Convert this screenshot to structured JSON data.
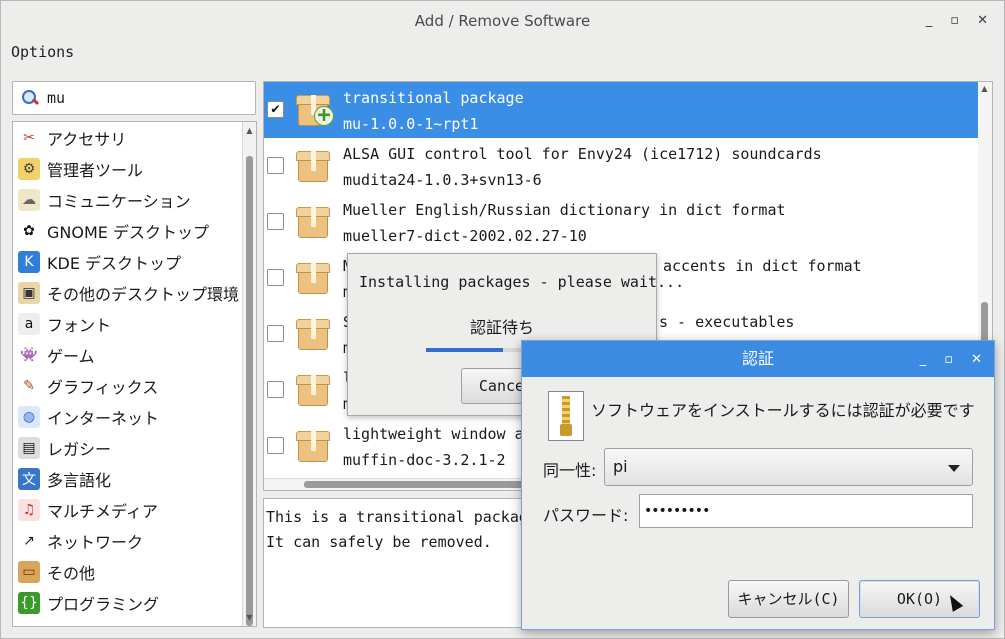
{
  "window": {
    "title": "Add / Remove Software",
    "controls": [
      "_",
      "▫",
      "✕"
    ]
  },
  "menu": {
    "options": "Options"
  },
  "search": {
    "value": "mu"
  },
  "categories": [
    {
      "label": "アクセサリ",
      "icon": "accessories-icon"
    },
    {
      "label": "管理者ツール",
      "icon": "admin-tools-icon"
    },
    {
      "label": "コミュニケーション",
      "icon": "communication-icon"
    },
    {
      "label": "GNOME デスクトップ",
      "icon": "gnome-icon"
    },
    {
      "label": "KDE デスクトップ",
      "icon": "kde-icon"
    },
    {
      "label": "その他のデスクトップ環境",
      "icon": "other-desktop-icon"
    },
    {
      "label": "フォント",
      "icon": "font-icon"
    },
    {
      "label": "ゲーム",
      "icon": "games-icon"
    },
    {
      "label": "グラフィックス",
      "icon": "graphics-icon"
    },
    {
      "label": "インターネット",
      "icon": "internet-icon"
    },
    {
      "label": "レガシー",
      "icon": "legacy-icon"
    },
    {
      "label": "多言語化",
      "icon": "localization-icon"
    },
    {
      "label": "マルチメディア",
      "icon": "multimedia-icon"
    },
    {
      "label": "ネットワーク",
      "icon": "network-icon"
    },
    {
      "label": "その他",
      "icon": "other-icon"
    },
    {
      "label": "プログラミング",
      "icon": "programming-icon"
    }
  ],
  "packages": [
    {
      "summary": "transitional package",
      "name": "mu-1.0.0-1~rpt1",
      "checked": true
    },
    {
      "summary": "ALSA GUI control tool for Envy24 (ice1712) soundcards",
      "name": "mudita24-1.0.3+svn13-6",
      "checked": false
    },
    {
      "summary": "Mueller English/Russian dictionary in dict format",
      "name": "mueller7-dict-2002.02.27-10",
      "checked": false
    },
    {
      "summary": "accents in dict format",
      "name": "m",
      "prefix": "M",
      "checked": false
    },
    {
      "summary": "s - executables",
      "name": "m",
      "prefix": "S",
      "checked": false
    },
    {
      "summary": "",
      "name": "m",
      "prefix": "l",
      "checked": false
    },
    {
      "summary": "lightweight window and",
      "name": "muffin-doc-3.2.1-2",
      "checked": false
    }
  ],
  "description": [
    "This is a transitional package.",
    "It can safely be removed."
  ],
  "progress_dialog": {
    "title": "Installing packages - please wait...",
    "status": "認証待ち",
    "progress": 0.5,
    "cancel": "Cancel"
  },
  "auth_dialog": {
    "title": "認証",
    "message": "ソフトウェアをインストールするには認証が必要です",
    "identity_label": "同一性:",
    "identity_value": "pi",
    "password_label": "パスワード:",
    "password_value": "•••••••••",
    "cancel": "キャンセル(C)",
    "ok": "OK(O)"
  }
}
